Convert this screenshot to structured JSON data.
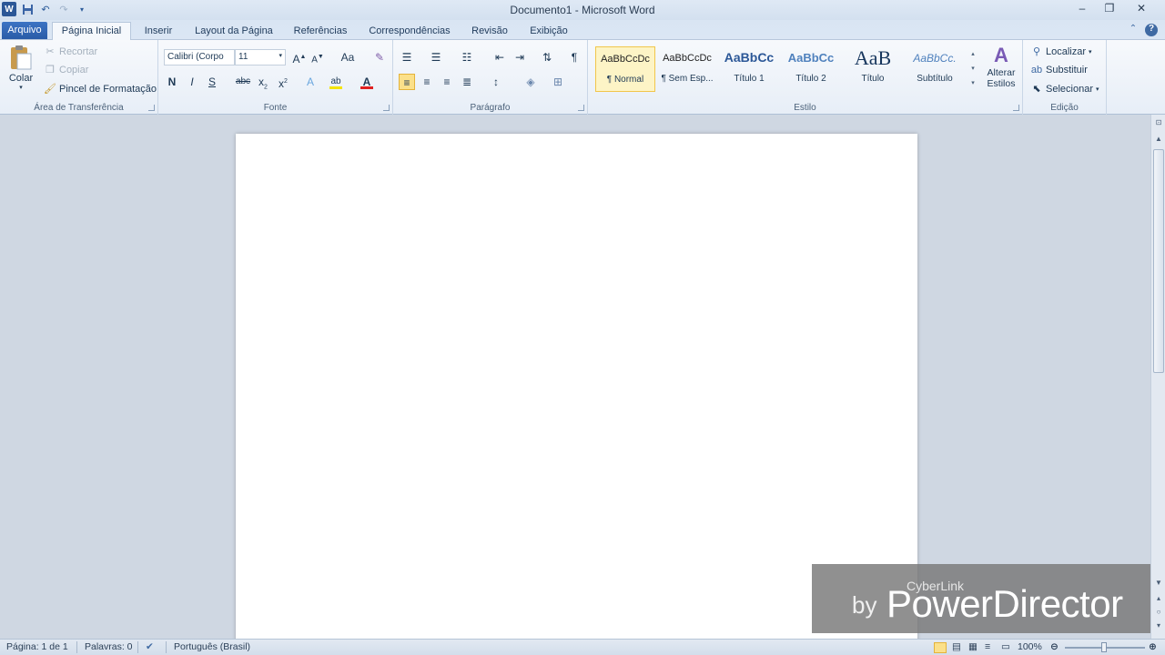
{
  "window": {
    "title": "Documento1 - Microsoft Word",
    "app_icon": "W"
  },
  "tabs": {
    "file": "Arquivo",
    "items": [
      "Página Inicial",
      "Inserir",
      "Layout da Página",
      "Referências",
      "Correspondências",
      "Revisão",
      "Exibição"
    ],
    "active": "Página Inicial"
  },
  "clipboard": {
    "paste": "Colar",
    "cut": "Recortar",
    "copy": "Copiar",
    "format_painter": "Pincel de Formatação",
    "label": "Área de Transferência"
  },
  "font": {
    "name": "Calibri (Corpo",
    "size": "11",
    "grow": "A",
    "shrink": "A",
    "case": "Aa",
    "bold": "N",
    "italic": "I",
    "underline": "S",
    "strike": "abc",
    "subscript": "x",
    "superscript": "x",
    "effects": "A",
    "highlight": "ab",
    "color": "A",
    "label": "Fonte"
  },
  "paragraph": {
    "label": "Parágrafo",
    "pilcrow": "¶"
  },
  "styles": {
    "label": "Estilo",
    "items": [
      {
        "preview": "AaBbCcDc",
        "name": "¶ Normal"
      },
      {
        "preview": "AaBbCcDc",
        "name": "¶ Sem Esp..."
      },
      {
        "preview": "AaBbCc",
        "name": "Título 1"
      },
      {
        "preview": "AaBbCc",
        "name": "Título 2"
      },
      {
        "preview": "AaB",
        "name": "Título"
      },
      {
        "preview": "AaBbCc.",
        "name": "Subtítulo"
      }
    ],
    "change": "Alterar Estilos"
  },
  "editing": {
    "label": "Edição",
    "find": "Localizar",
    "replace": "Substituir",
    "select": "Selecionar"
  },
  "status": {
    "page": "Página: 1 de 1",
    "words": "Palavras: 0",
    "language": "Português (Brasil)",
    "zoom": "100%"
  },
  "watermark": {
    "brand": "CyberLink",
    "by": "by",
    "product": "PowerDirector"
  },
  "colors": {
    "accent": "#2b5797",
    "selected_style_bg": "#fdf4c6",
    "selected_style_border": "#f1c64b",
    "font_color_bar": "#e02020",
    "highlight_bar": "#f5e400"
  }
}
